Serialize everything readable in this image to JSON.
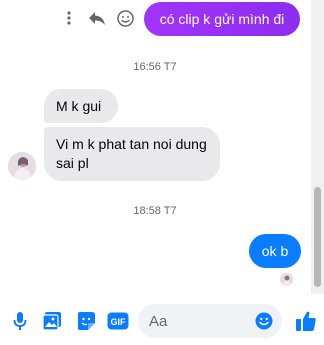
{
  "messages": {
    "outgoing_top": "có clip k gửi mình đi",
    "timestamp_1": "16:56 T7",
    "incoming_1": "M k gui",
    "incoming_2": "Vi m k phat tan noi dung sai pl",
    "timestamp_2": "18:58 T7",
    "outgoing_bottom": "ok b"
  },
  "composer": {
    "placeholder": "Aa"
  },
  "colors": {
    "outgoing_purple": "#9b31f5",
    "outgoing_blue": "#0a7cff",
    "incoming_bg": "#e9e9eb",
    "accent": "#0a7cff"
  },
  "icons": {
    "more": "more-vertical-icon",
    "reply": "reply-icon",
    "react": "smiley-icon",
    "mic": "microphone-icon",
    "image": "image-icon",
    "sticker": "sticker-icon",
    "gif": "gif-icon",
    "emoji": "emoji-icon",
    "like": "thumbs-up-icon"
  }
}
